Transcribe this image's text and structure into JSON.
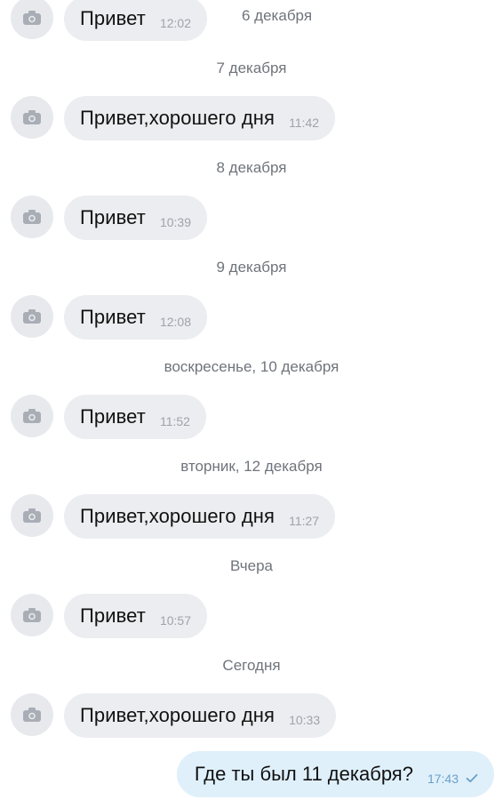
{
  "messages": [
    {
      "text": "Привет",
      "time": "12:02"
    },
    {
      "text": "Привет,хорошего дня",
      "time": "11:42"
    },
    {
      "text": "Привет",
      "time": "10:39"
    },
    {
      "text": "Привет",
      "time": "12:08"
    },
    {
      "text": "Привет",
      "time": "11:52"
    },
    {
      "text": "Привет,хорошего дня",
      "time": "11:27"
    },
    {
      "text": "Привет",
      "time": "10:57"
    },
    {
      "text": "Привет,хорошего дня",
      "time": "10:33"
    }
  ],
  "date_separators": [
    "6 декабря",
    "7 декабря",
    "8 декабря",
    "9 декабря",
    "воскресенье, 10 декабря",
    "вторник, 12 декабря",
    "Вчера",
    "Сегодня"
  ],
  "outgoing": {
    "text": "Где ты был 11 декабря?",
    "time": "17:43",
    "status_icon": "checkmark-icon"
  },
  "avatar_icon": "camera-icon",
  "colors": {
    "incoming_bubble": "#ecedf0",
    "outgoing_bubble": "#dff0fb",
    "avatar_bg": "#e7e9ed"
  }
}
